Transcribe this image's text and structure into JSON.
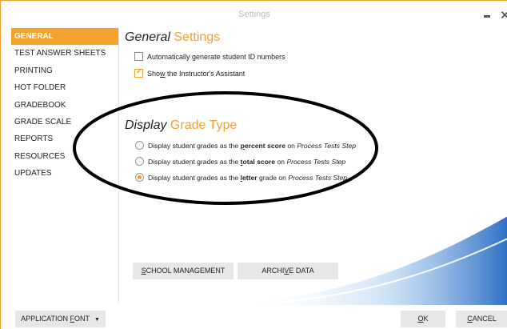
{
  "window": {
    "title": "Settings"
  },
  "sidebar": {
    "items": [
      {
        "label": "GENERAL",
        "active": true
      },
      {
        "label": "TEST ANSWER SHEETS",
        "active": false
      },
      {
        "label": "PRINTING",
        "active": false
      },
      {
        "label": "HOT FOLDER",
        "active": false
      },
      {
        "label": "GRADEBOOK",
        "active": false
      },
      {
        "label": "GRADE SCALE",
        "active": false
      },
      {
        "label": "REPORTS",
        "active": false
      },
      {
        "label": "RESOURCES",
        "active": false
      },
      {
        "label": "UPDATES",
        "active": false
      }
    ]
  },
  "general": {
    "heading_italic": "General",
    "heading_accent": "Settings",
    "auto_id": {
      "label_before": "Automatically ",
      "label_key": "g",
      "label_after": "enerate student ID numbers",
      "checked": false
    },
    "assistant": {
      "label_before": "Sho",
      "label_key": "w",
      "label_after": " the Instructor's Assistant",
      "checked": true
    }
  },
  "grade_type": {
    "heading_italic": "Display",
    "heading_accent": "Grade Type",
    "options": [
      {
        "prefix": "Display student grades as the ",
        "bold": "percent score",
        "suffix": " on ",
        "italic": "Process Tests Step",
        "selected": false
      },
      {
        "prefix": "Display student grades as the ",
        "bold": "total score",
        "suffix": " on ",
        "italic": "Process Tests Step",
        "selected": false
      },
      {
        "prefix": "Display student grades as the ",
        "bold": "letter",
        "suffix": " grade on ",
        "italic": "Process Tests Step",
        "selected": true
      }
    ]
  },
  "buttons": {
    "school_management": "SCHOOL MANAGEMENT",
    "archive_data": "ARCHIVE DATA",
    "application_font": "APPLICATION FONT",
    "ok": "OK",
    "cancel": "CANCEL"
  },
  "colors": {
    "accent": "#f0a030",
    "button_bg": "#e7e7e7",
    "swoosh": "#3a78c8"
  }
}
